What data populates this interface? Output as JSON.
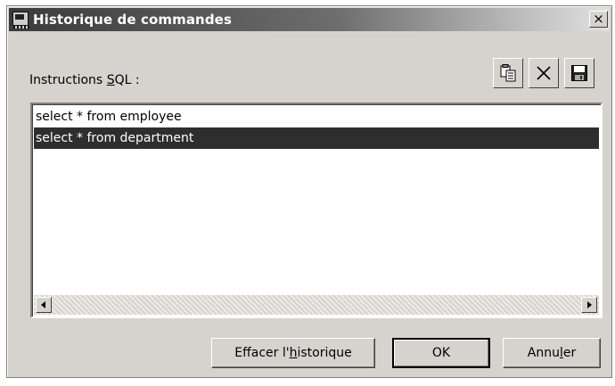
{
  "window": {
    "title": "Historique de commandes",
    "close_glyph": "×"
  },
  "label": {
    "before": "Instructions ",
    "mnemonic": "S",
    "after": "QL :"
  },
  "toolbar": {
    "icons": [
      "copy-icon",
      "delete-icon",
      "save-icon"
    ]
  },
  "history": {
    "items": [
      {
        "text": "select * from employee",
        "selected": false
      },
      {
        "text": "select * from department",
        "selected": true
      }
    ]
  },
  "buttons": {
    "clear": {
      "before": "Effacer l'",
      "mnemonic": "h",
      "after": "istorique"
    },
    "ok": "OK",
    "cancel": {
      "before": "Annu",
      "mnemonic": "l",
      "after": "er"
    }
  },
  "colors": {
    "dialog_bg": "#d6d3ce",
    "selection_bg": "#2e2e2e",
    "selection_text": "#ffffff"
  }
}
